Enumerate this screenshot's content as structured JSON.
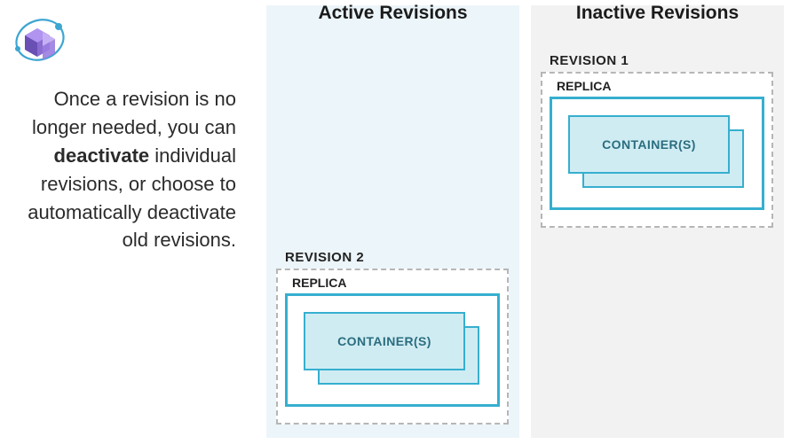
{
  "description": {
    "pre": "Once a revision is no longer needed, you can ",
    "bold": "deactivate",
    "post": " individual revisions, or choose to automatically deactivate old revisions."
  },
  "panels": {
    "active": {
      "title": "Active Revisions",
      "revision": {
        "label": "REVISION 2",
        "replica_label": "REPLICA",
        "container_label": "CONTAINER(S)"
      }
    },
    "inactive": {
      "title": "Inactive Revisions",
      "revision": {
        "label": "REVISION 1",
        "replica_label": "REPLICA",
        "container_label": "CONTAINER(S)"
      }
    }
  },
  "colors": {
    "active_bg": "#ecf5f9",
    "inactive_bg": "#f2f2f2",
    "teal_border": "#36afcf",
    "teal_fill": "#d0ecf3",
    "dash": "#b6b6b6"
  }
}
